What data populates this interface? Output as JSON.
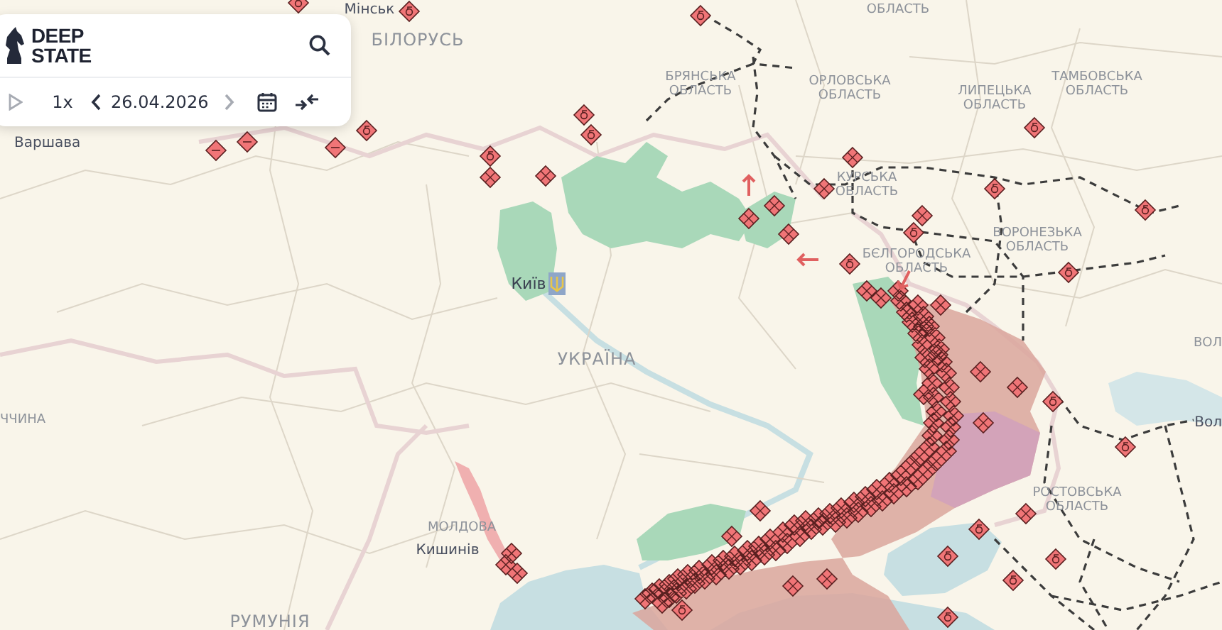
{
  "panel": {
    "brand": "DEEP STATE",
    "play": {
      "disabled": true
    },
    "speed": "1x",
    "previous": {
      "disabled": false
    },
    "date": "26.04.2026",
    "next": {
      "disabled": true
    }
  },
  "map_labels": [
    {
      "text": "Мінськ",
      "kind": "city"
    },
    {
      "text": "БІЛОРУСЬ",
      "kind": "country"
    },
    {
      "text": "Варшава",
      "kind": "city"
    },
    {
      "text": "ОБЛАСТЬ",
      "kind": "region"
    },
    {
      "text": "БРЯНСЬКА ОБЛАСТЬ",
      "kind": "region"
    },
    {
      "text": "ОРЛОВСЬКА ОБЛАСТЬ",
      "kind": "region"
    },
    {
      "text": "ЛИПЕЦЬКА ОБЛАСТЬ",
      "kind": "region"
    },
    {
      "text": "ТАМБОВСЬКА ОБЛАСТЬ",
      "kind": "region"
    },
    {
      "text": "КУРСЬКА ОБЛАСТЬ",
      "kind": "region"
    },
    {
      "text": "ВОРОНЕЗЬКА ОБЛАСТЬ",
      "kind": "region"
    },
    {
      "text": "БЄЛГОРОДСЬКА ОБЛАСТЬ",
      "kind": "region"
    },
    {
      "text": "Київ",
      "kind": "capital"
    },
    {
      "text": "УКРАЇНА",
      "kind": "country"
    },
    {
      "text": "ВОЛ",
      "kind": "region"
    },
    {
      "text": "ЧЧИНА",
      "kind": "region"
    },
    {
      "text": "Вол",
      "kind": "city"
    },
    {
      "text": "РОСТОВСЬКА ОБЛАСТЬ",
      "kind": "region"
    },
    {
      "text": "МОЛДОВА",
      "kind": "region"
    },
    {
      "text": "Кишинів",
      "kind": "city"
    },
    {
      "text": "РУМУНІЯ",
      "kind": "country"
    }
  ]
}
